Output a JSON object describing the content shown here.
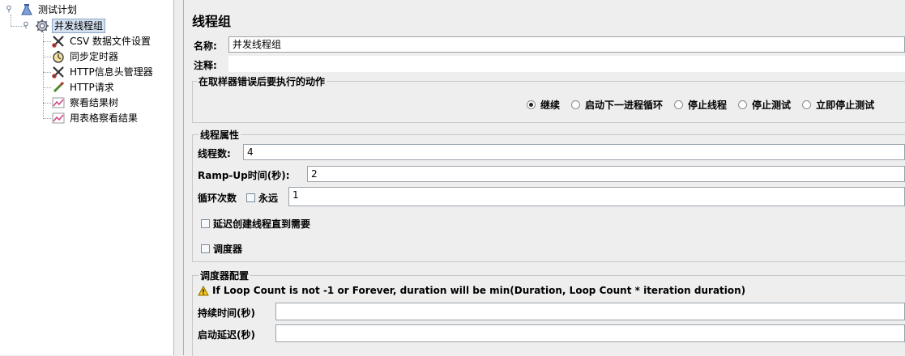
{
  "tree": {
    "root": {
      "label": "测试计划",
      "icon": "test-plan-icon"
    },
    "thread_group": {
      "label": "并发线程组",
      "icon": "gear-icon"
    },
    "children": [
      {
        "label": "CSV 数据文件设置",
        "icon": "wrench-scissors-icon"
      },
      {
        "label": "同步定时器",
        "icon": "stopwatch-icon"
      },
      {
        "label": "HTTP信息头管理器",
        "icon": "wrench-scissors-icon"
      },
      {
        "label": "HTTP请求",
        "icon": "pipette-icon"
      },
      {
        "label": "察看结果树",
        "icon": "graph-icon"
      },
      {
        "label": "用表格察看结果",
        "icon": "graph-icon"
      }
    ]
  },
  "panel": {
    "title": "线程组",
    "name_label": "名称:",
    "name_value": "并发线程组",
    "comment_label": "注释:",
    "comment_value": ""
  },
  "error_action": {
    "title": "在取样器错误后要执行的动作",
    "options": [
      "继续",
      "启动下一进程循环",
      "停止线程",
      "停止测试",
      "立即停止测试"
    ],
    "selected": "继续"
  },
  "thread_props": {
    "title": "线程属性",
    "threads_label": "线程数:",
    "threads_value": "4",
    "rampup_label": "Ramp-Up时间(秒):",
    "rampup_value": "2",
    "loop_label": "循环次数",
    "forever_label": "永远",
    "loop_value": "1",
    "delay_label": "延迟创建线程直到需要",
    "scheduler_label": "调度器"
  },
  "scheduler_config": {
    "title": "调度器配置",
    "warning": "If Loop Count is not -1 or Forever, duration will be min(Duration, Loop Count * iteration duration)",
    "duration_label": "持续时间(秒)",
    "duration_value": "",
    "startup_delay_label": "启动延迟(秒)",
    "startup_delay_value": ""
  }
}
